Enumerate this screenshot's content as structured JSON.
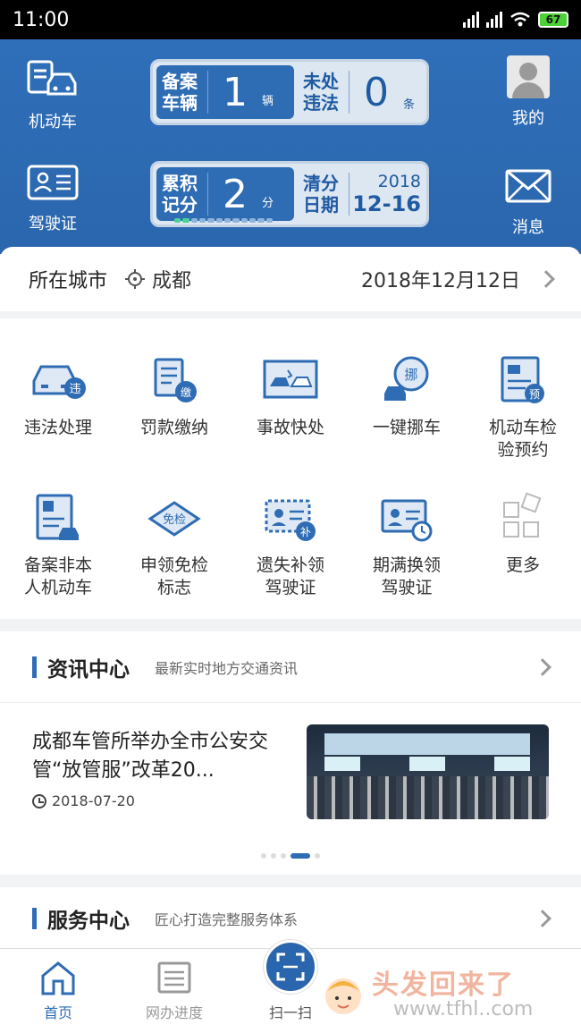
{
  "status": {
    "time": "11:00",
    "battery": "67"
  },
  "header": {
    "vehicle_label": "机动车",
    "license_label": "驾驶证",
    "mine_label": "我的",
    "messages_label": "消息",
    "panel1": {
      "left_label_1": "备案",
      "left_label_2": "车辆",
      "left_num": "1",
      "left_unit": "辆",
      "right_label_1": "未处",
      "right_label_2": "违法",
      "right_num": "0",
      "right_unit": "条"
    },
    "panel2": {
      "left_label_1": "累积",
      "left_label_2": "记分",
      "left_num": "2",
      "left_unit": "分",
      "right_label_1": "清分",
      "right_label_2": "日期",
      "year": "2018",
      "monthday": "12-16"
    }
  },
  "city": {
    "label": "所在城市",
    "name": "成都",
    "date": "2018年12月12日"
  },
  "services": [
    {
      "label": "违法处理",
      "icon": "car-violation-icon"
    },
    {
      "label": "罚款缴纳",
      "icon": "fine-payment-icon"
    },
    {
      "label": "事故快处",
      "icon": "accident-icon"
    },
    {
      "label": "一键挪车",
      "icon": "move-car-icon"
    },
    {
      "label": "机动车检验预约",
      "icon": "inspection-icon"
    },
    {
      "label": "备案非本人机动车",
      "icon": "register-vehicle-icon"
    },
    {
      "label": "申领免检标志",
      "icon": "exemption-icon"
    },
    {
      "label": "遗失补领驾驶证",
      "icon": "lost-license-icon"
    },
    {
      "label": "期满换领驾驶证",
      "icon": "renew-license-icon"
    },
    {
      "label": "更多",
      "icon": "more-icon"
    }
  ],
  "news": {
    "title": "资讯中心",
    "subtitle": "最新实时地方交通资讯",
    "item_title": "成都车管所举办全市公安交管“放管服”改革20...",
    "item_date": "2018-07-20"
  },
  "service_center": {
    "title": "服务中心",
    "subtitle": "匠心打造完整服务体系"
  },
  "tabs": {
    "home": "首页",
    "progress": "网办进度",
    "scan": "扫一扫",
    "watermark": "头发回来了",
    "watermark_url": "www.tfhl..com"
  },
  "colors": {
    "primary": "#2e6cb4",
    "header_bg": "#2f6fb9"
  }
}
